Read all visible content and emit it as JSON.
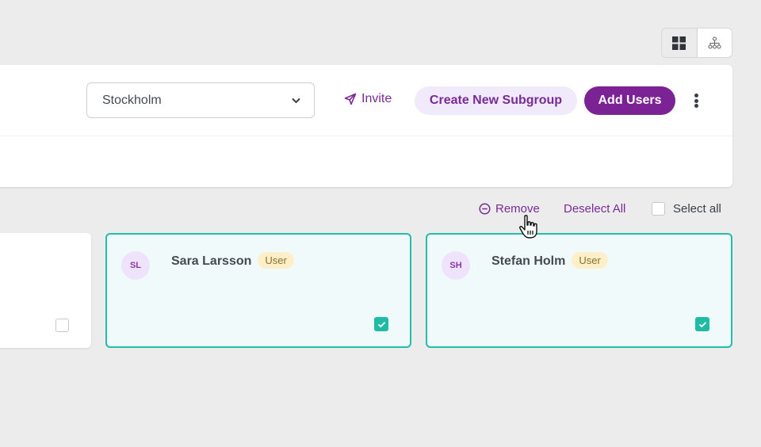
{
  "view_toggle": {
    "options": [
      {
        "name": "grid-view",
        "icon": "grid-icon",
        "active": true
      },
      {
        "name": "hierarchy-view",
        "icon": "hierarchy-icon",
        "active": false
      }
    ]
  },
  "header": {
    "location_select": {
      "value": "Stockholm",
      "icon": "chevron-down-icon"
    },
    "invite_label": "Invite",
    "invite_icon": "paper-plane-icon",
    "create_subgroup_label": "Create New Subgroup",
    "add_users_label": "Add Users",
    "more_icon": "kebab-menu-icon"
  },
  "actions": {
    "remove_label": "Remove",
    "remove_icon": "minus-circle-icon",
    "deselect_all_label": "Deselect All",
    "select_all_label": "Select all",
    "select_all_checked": false
  },
  "users": [
    {
      "initials": "",
      "name": "",
      "role": "",
      "selected": false
    },
    {
      "initials": "SL",
      "name": "Sara Larsson",
      "role": "User",
      "selected": true
    },
    {
      "initials": "SH",
      "name": "Stefan Holm",
      "role": "User",
      "selected": true
    }
  ],
  "colors": {
    "brand_purple": "#7b2395",
    "selected_border": "#21bfa9",
    "role_badge_bg": "#fdf0c9"
  }
}
